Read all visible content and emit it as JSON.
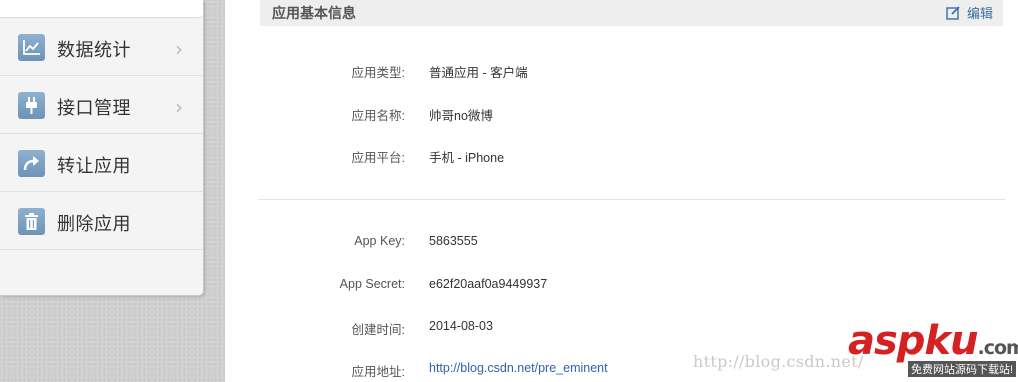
{
  "sidebar": {
    "items": [
      {
        "label": "数据统计",
        "icon": "chart-icon",
        "has_arrow": true
      },
      {
        "label": "接口管理",
        "icon": "plug-icon",
        "has_arrow": true
      },
      {
        "label": "转让应用",
        "icon": "share-arrow-icon",
        "has_arrow": false
      },
      {
        "label": "删除应用",
        "icon": "trash-icon",
        "has_arrow": false
      }
    ],
    "icon_color": "#7ea3c4"
  },
  "panel": {
    "title": "应用基本信息",
    "edit_label": "编辑"
  },
  "basic_info": [
    {
      "label": "应用类型:",
      "value": "普通应用  -  客户端"
    },
    {
      "label": "应用名称:",
      "value": "帅哥no微博"
    },
    {
      "label": "应用平台:",
      "value": "手机  -  iPhone"
    }
  ],
  "key_info": [
    {
      "label": "App Key:",
      "value": "5863555"
    },
    {
      "label": "App Secret:",
      "value": "e62f20aaf0a9449937"
    },
    {
      "label": "创建时间:",
      "value": "2014-08-03"
    },
    {
      "label": "应用地址:",
      "value": "http://blog.csdn.net/pre_eminent"
    }
  ],
  "watermark": {
    "url": "http://blog.csdn.net/",
    "logo": "aspku",
    "logo_suffix": ".com",
    "tagline": "免费网站源码下载站!"
  }
}
